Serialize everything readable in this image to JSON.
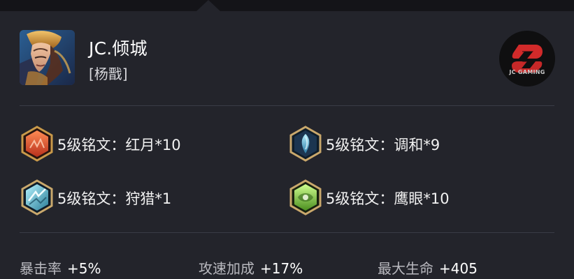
{
  "profile": {
    "player_name": "JC.倾城",
    "hero_name": "[杨戬]"
  },
  "team": {
    "logo_text": "JC GAMING"
  },
  "inscriptions": [
    {
      "label": "5级铭文：红月*10",
      "icon": "red-moon-rune-icon",
      "color": "#d2562b"
    },
    {
      "label": "5级铭文：调和*9",
      "icon": "harmony-rune-icon",
      "color": "#58a7c9"
    },
    {
      "label": "5级铭文：狩猎*1",
      "icon": "hunt-rune-icon",
      "color": "#66b7d1"
    },
    {
      "label": "5级铭文：鹰眼*10",
      "icon": "eagle-eye-rune-icon",
      "color": "#7bb63a"
    }
  ],
  "stats": [
    {
      "key": "暴击率",
      "value": "+5%"
    },
    {
      "key": "攻速加成",
      "value": "+17%"
    },
    {
      "key": "最大生命",
      "value": "+405"
    }
  ]
}
